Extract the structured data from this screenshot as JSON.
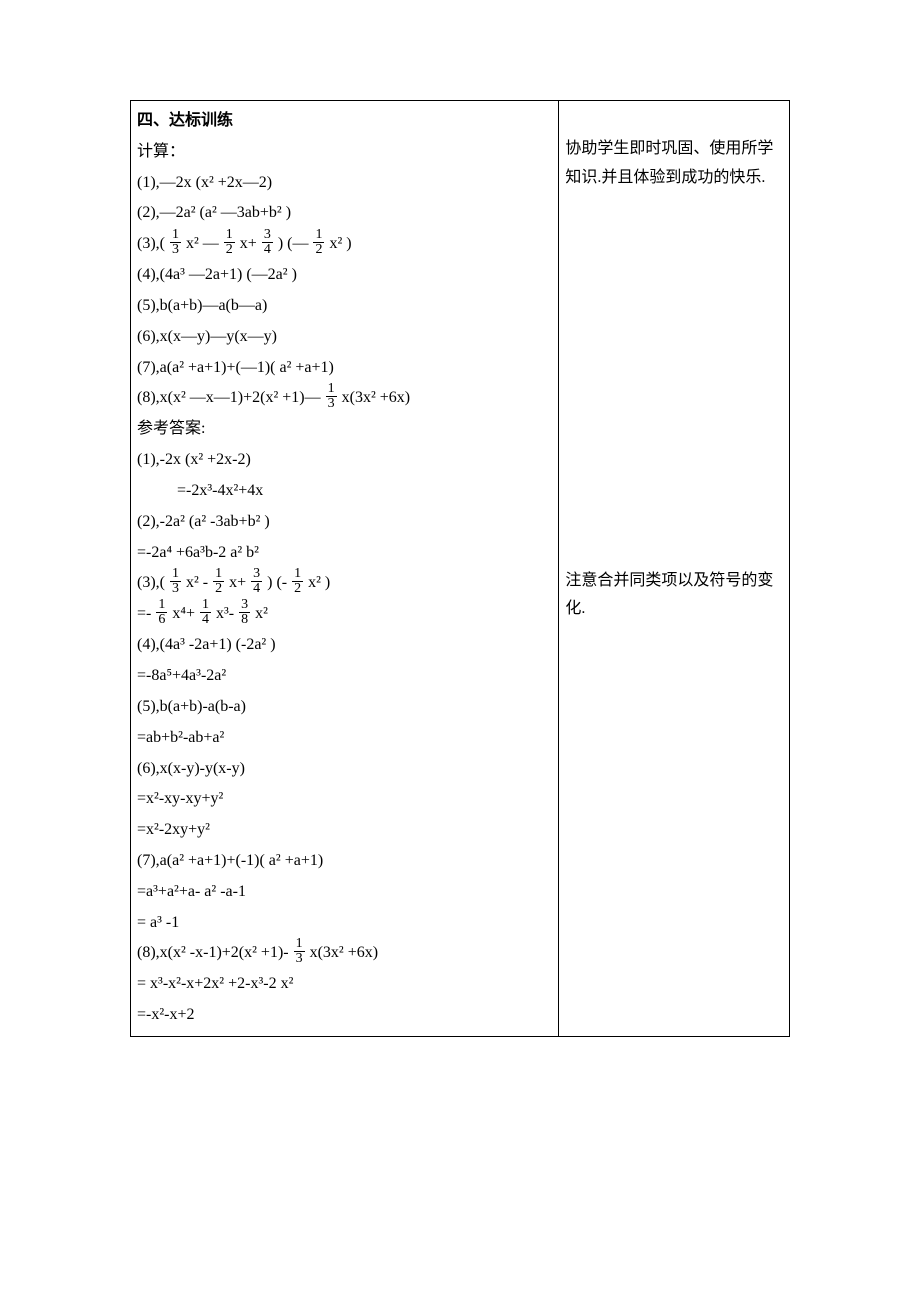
{
  "section_title": "四、达标训练",
  "compute_label": "计算：",
  "problems": {
    "p1": "(1),—2x (x² +2x—2)",
    "p2": "(2),—2a²  (a² —3ab+b² )",
    "p3_prefix": "(3),(",
    "p3_frac1_n": "1",
    "p3_frac1_d": "3",
    "p3_mid1": "x² —",
    "p3_frac2_n": "1",
    "p3_frac2_d": "2",
    "p3_mid2": "x+",
    "p3_frac3_n": "3",
    "p3_frac3_d": "4",
    "p3_mid3": ") (—",
    "p3_frac4_n": "1",
    "p3_frac4_d": "2",
    "p3_suffix": "x² )",
    "p4": "(4),(4a³ —2a+1) (—2a² )",
    "p5": "(5),b(a+b)—a(b—a)",
    "p6": "(6),x(x—y)—y(x—y)",
    "p7": "(7),a(a² +a+1)+(—1)( a² +a+1)",
    "p8_prefix": "(8),x(x² —x—1)+2(x² +1)—",
    "p8_frac_n": "1",
    "p8_frac_d": "3",
    "p8_suffix": "x(3x² +6x)"
  },
  "answer_label": "参考答案:",
  "answers": {
    "a1_line1": "(1),-2x (x² +2x-2)",
    "a1_line2": "=-2x³-4x²+4x",
    "a2_line1": "(2),-2a²  (a² -3ab+b² )",
    "a2_line2": "=-2a⁴ +6a³b-2 a² b²",
    "a3_prefix": "(3),(",
    "a3_f1n": "1",
    "a3_f1d": "3",
    "a3_m1": "x² -",
    "a3_f2n": "1",
    "a3_f2d": "2",
    "a3_m2": "x+",
    "a3_f3n": "3",
    "a3_f3d": "4",
    "a3_m3": ") (-",
    "a3_f4n": "1",
    "a3_f4d": "2",
    "a3_suffix": "x² )",
    "a3r_prefix": "=-",
    "a3r_f1n": "1",
    "a3r_f1d": "6",
    "a3r_m1": "x⁴+",
    "a3r_f2n": "1",
    "a3r_f2d": "4",
    "a3r_m2": "x³-",
    "a3r_f3n": "3",
    "a3r_f3d": "8",
    "a3r_suffix": "x²",
    "a4_line1": "(4),(4a³ -2a+1) (-2a² )",
    "a4_line2": "=-8a⁵+4a³-2a²",
    "a5_line1": "(5),b(a+b)-a(b-a)",
    "a5_line2": "=ab+b²-ab+a²",
    "a6_line1": "(6),x(x-y)-y(x-y)",
    "a6_line2": "=x²-xy-xy+y²",
    "a6_line3": "=x²-2xy+y²",
    "a7_line1": "(7),a(a² +a+1)+(-1)( a² +a+1)",
    "a7_line2": "=a³+a²+a- a² -a-1",
    "a7_line3": "= a³ -1",
    "a8_prefix": "(8),x(x² -x-1)+2(x² +1)-",
    "a8_f1n": "1",
    "a8_f1d": "3",
    "a8_suffix": "x(3x² +6x)",
    "a8_line2": "= x³-x²-x+2x² +2-x³-2 x²",
    "a8_line3": "=-x²-x+2"
  },
  "notes": {
    "note1": "协助学生即时巩固、使用所学知识.并且体验到成功的快乐.",
    "note2": "注意合并同类项以及符号的变化."
  }
}
